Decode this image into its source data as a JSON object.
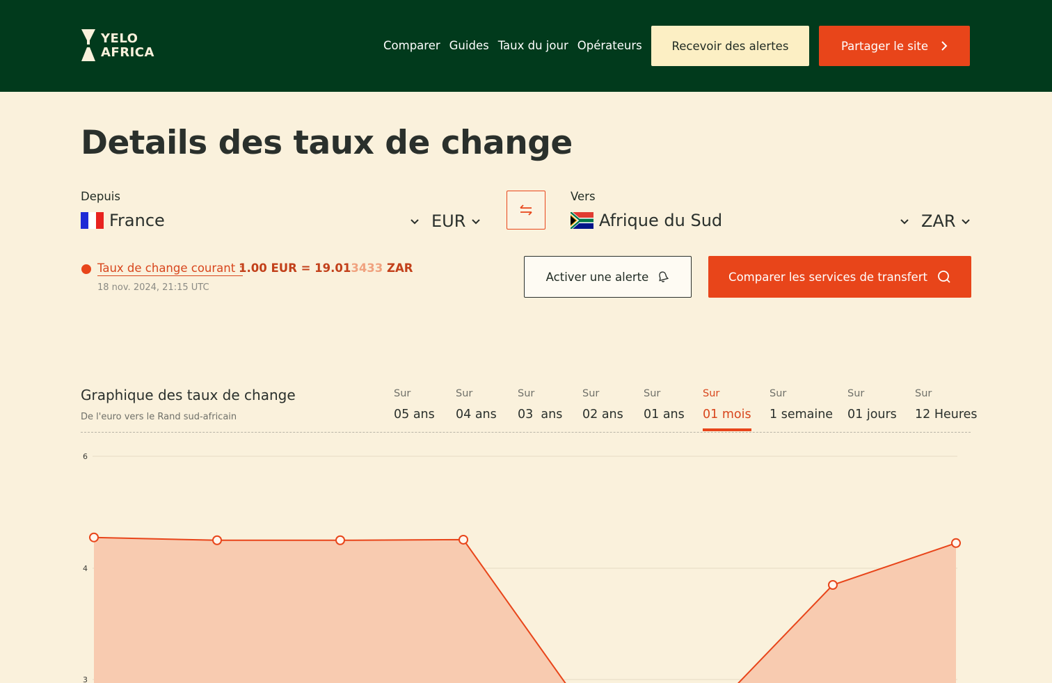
{
  "brand": {
    "line1": "YELO",
    "line2": "AFRICA"
  },
  "nav": {
    "items": [
      "Comparer",
      "Guides",
      "Taux du jour",
      "Opérateurs"
    ],
    "alerts_button": "Recevoir des alertes",
    "share_button": "Partager le site"
  },
  "page_title": "Details des taux de change",
  "from": {
    "label": "Depuis",
    "country": "France",
    "currency": "EUR"
  },
  "to": {
    "label": "Vers",
    "country": "Afrique du Sud",
    "currency": "ZAR"
  },
  "rate": {
    "label": "Taux de change courant :",
    "value_main": "1.00 EUR = 19.01",
    "value_faded": "3433",
    "value_unit": " ZAR",
    "date": "18 nov. 2024, 21:15 UTC"
  },
  "actions": {
    "alert_button": "Activer une alerte",
    "compare_button": "Comparer les services de transfert"
  },
  "chart_section": {
    "title": "Graphique des taux de change",
    "subtitle": "De l'euro vers le Rand sud-africain",
    "periods": [
      {
        "prefix": "Sur",
        "label": "05 ans"
      },
      {
        "prefix": "Sur",
        "label": "04 ans"
      },
      {
        "prefix": "Sur",
        "label": "03  ans"
      },
      {
        "prefix": "Sur",
        "label": "02 ans"
      },
      {
        "prefix": "Sur",
        "label": "01 ans"
      },
      {
        "prefix": "Sur",
        "label": "01 mois",
        "active": true
      },
      {
        "prefix": "Sur",
        "label": "1 semaine"
      },
      {
        "prefix": "Sur",
        "label": "01 jours"
      },
      {
        "prefix": "Sur",
        "label": "12 Heures"
      }
    ]
  },
  "colors": {
    "header_bg": "#013a1c",
    "accent": "#e8451a",
    "page_bg": "#faf1dc",
    "area_fill": "#f8cbb0"
  },
  "chart_data": {
    "type": "area",
    "title": "",
    "xlabel": "",
    "ylabel": "",
    "y_ticks": [
      "6",
      "4",
      "3"
    ],
    "points": [
      4.55,
      4.5,
      4.5,
      4.51,
      2.7,
      2.7,
      3.85,
      4.45
    ],
    "marked": [
      true,
      true,
      true,
      true,
      false,
      false,
      true,
      true
    ]
  }
}
